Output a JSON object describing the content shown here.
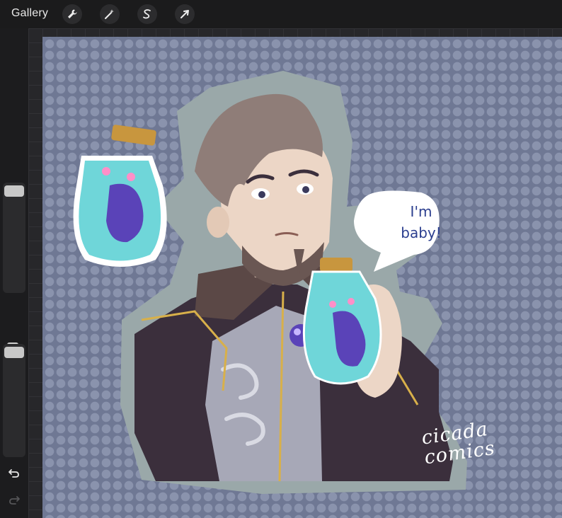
{
  "toolbar": {
    "gallery_label": "Gallery",
    "tools": [
      {
        "name": "actions",
        "icon": "wrench-icon"
      },
      {
        "name": "adjustments",
        "icon": "magic-wand-icon"
      },
      {
        "name": "selection",
        "icon": "selection-s-icon"
      },
      {
        "name": "transform",
        "icon": "arrow-cursor-icon"
      }
    ]
  },
  "sidebar": {
    "brush_size_label": "",
    "opacity_label": "",
    "modify_icon": "square-icon",
    "undo_icon": "undo-icon",
    "redo_icon": "redo-icon"
  },
  "artwork": {
    "speech_bubble_line1": "I'm",
    "speech_bubble_line2": "baby!",
    "signature_line1": "cicada",
    "signature_line2": "comics",
    "colors": {
      "canvas_bg": "#6f7894",
      "dots": "#8a93ad",
      "sticker_outline": "#9aa8a9",
      "coat": "#3b2f3c",
      "gold_trim": "#d8b04a",
      "jar_glass": "#6fd6d9",
      "cicada": "#5a43b8",
      "hair": "#8f7d78",
      "skin": "#ecd6c6"
    }
  }
}
